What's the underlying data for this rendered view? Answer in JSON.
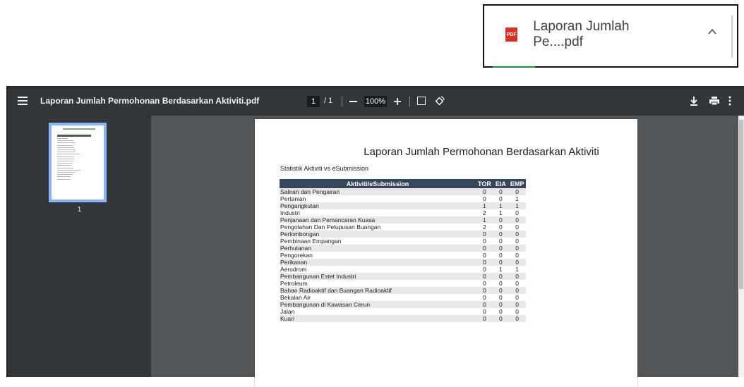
{
  "download": {
    "file_badge": "PDF",
    "file_name": "Laporan Jumlah Pe....pdf"
  },
  "toolbar": {
    "title": "Laporan Jumlah Permohonan Berdasarkan Aktiviti.pdf",
    "page_current": "1",
    "page_total": "/ 1",
    "zoom": "100%"
  },
  "sidebar": {
    "thumb_page_number": "1"
  },
  "document": {
    "title": "Laporan Jumlah Permohonan Berdasarkan Aktiviti",
    "subtitle": "Statistik Aktiviti vs eSubmission",
    "headers": [
      "Aktiviti/eSubmission",
      "TOR",
      "EIA",
      "EMP"
    ],
    "rows": [
      {
        "activity": "Saliran dan Pengairan",
        "tor": "0",
        "eia": "0",
        "emp": "0"
      },
      {
        "activity": "Pertanian",
        "tor": "0",
        "eia": "0",
        "emp": "1"
      },
      {
        "activity": "Pengangkutan",
        "tor": "1",
        "eia": "1",
        "emp": "1"
      },
      {
        "activity": "Industri",
        "tor": "2",
        "eia": "1",
        "emp": "0"
      },
      {
        "activity": "Penjanaan dan Pemancaran Kuasa",
        "tor": "1",
        "eia": "0",
        "emp": "0"
      },
      {
        "activity": "Pengolahan Dan Pelupusan Buangan",
        "tor": "2",
        "eia": "0",
        "emp": "0"
      },
      {
        "activity": "Perlombongan",
        "tor": "0",
        "eia": "0",
        "emp": "0"
      },
      {
        "activity": "Pembinaan Empangan",
        "tor": "0",
        "eia": "0",
        "emp": "0"
      },
      {
        "activity": "Perhutanan",
        "tor": "0",
        "eia": "0",
        "emp": "0"
      },
      {
        "activity": "Pengorekan",
        "tor": "0",
        "eia": "0",
        "emp": "0"
      },
      {
        "activity": "Perikanan",
        "tor": "0",
        "eia": "0",
        "emp": "0"
      },
      {
        "activity": "Aerodrom",
        "tor": "0",
        "eia": "1",
        "emp": "1"
      },
      {
        "activity": "Pembangunan Estet Industri",
        "tor": "0",
        "eia": "0",
        "emp": "0"
      },
      {
        "activity": "Petroleum",
        "tor": "0",
        "eia": "0",
        "emp": "0"
      },
      {
        "activity": "Bahan Radioaktif dan Buangan Radioaktif",
        "tor": "0",
        "eia": "0",
        "emp": "0"
      },
      {
        "activity": "Bekalan Air",
        "tor": "0",
        "eia": "0",
        "emp": "0"
      },
      {
        "activity": "Pembangunan di Kawasan Cerun",
        "tor": "0",
        "eia": "0",
        "emp": "0"
      },
      {
        "activity": "Jalan",
        "tor": "0",
        "eia": "0",
        "emp": "0"
      },
      {
        "activity": "Kuari",
        "tor": "0",
        "eia": "0",
        "emp": "0"
      }
    ]
  },
  "colors": {
    "toolbar_bg": "#323639",
    "viewer_bg": "#525659",
    "table_header_bg": "#37475a",
    "thumb_highlight": "#8ab4f8",
    "pdf_badge": "#d93025"
  }
}
